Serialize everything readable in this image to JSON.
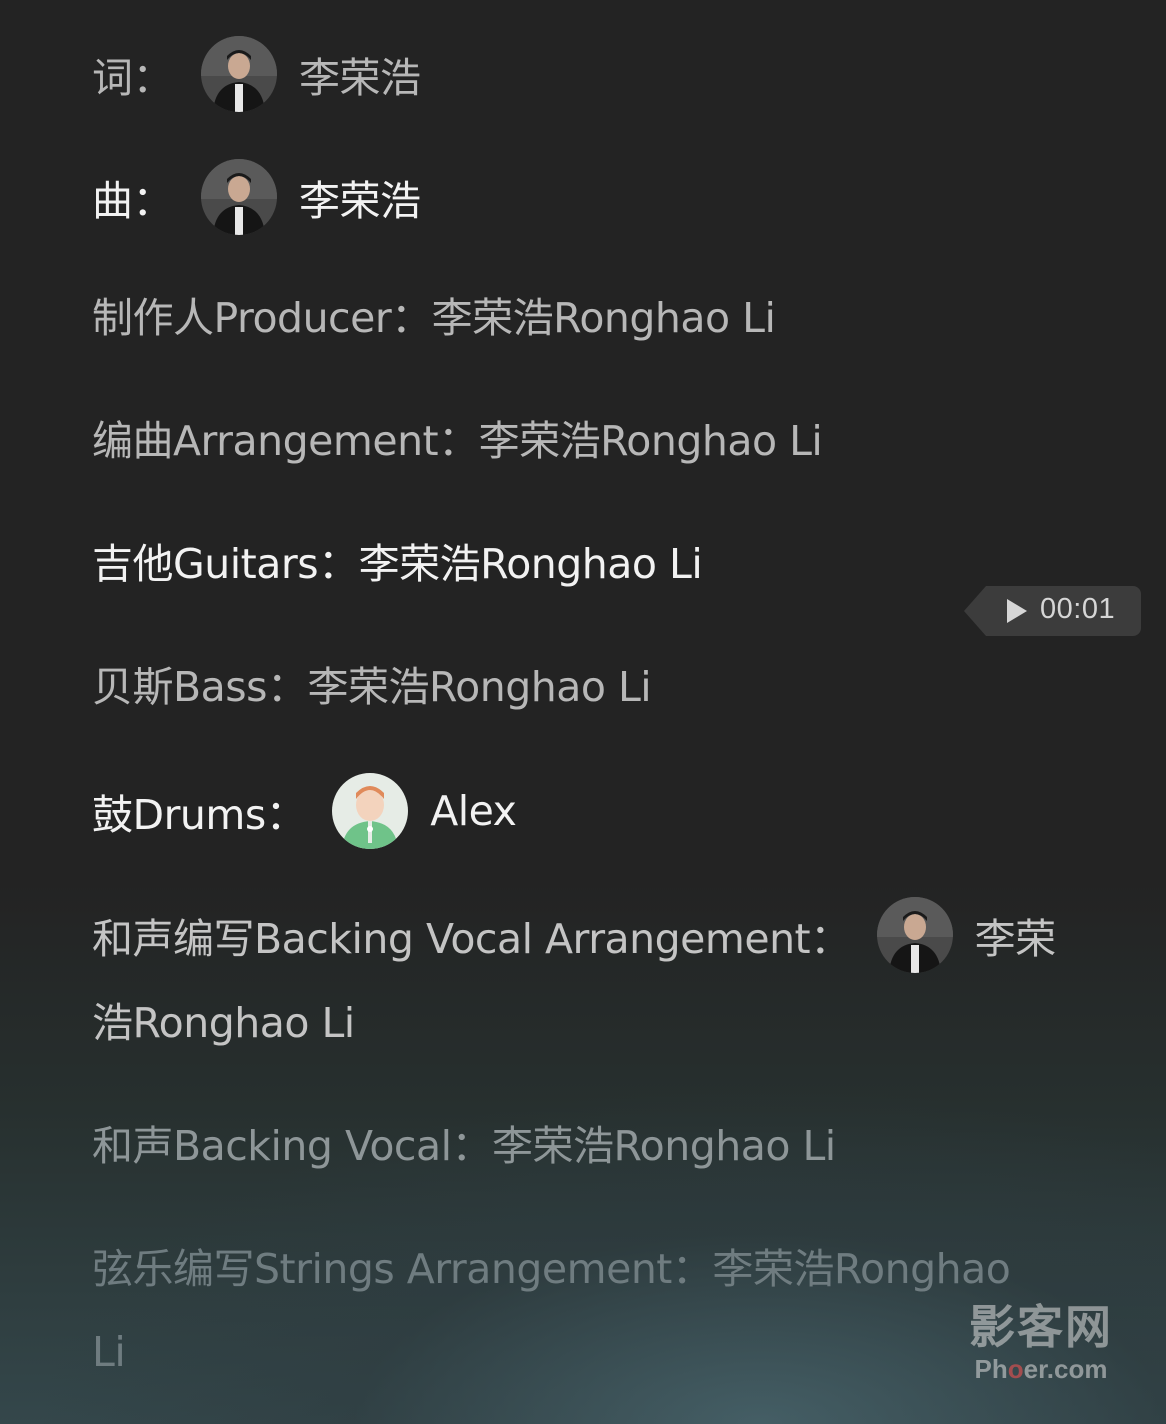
{
  "lyrics": {
    "line1": {
      "label": "词：",
      "name": "李荣浩"
    },
    "line2": {
      "label": "曲：",
      "name": "李荣浩"
    },
    "line3": {
      "text": "制作人Producer：李荣浩Ronghao Li"
    },
    "line4": {
      "text": "编曲Arrangement：李荣浩Ronghao Li"
    },
    "line5": {
      "text": "吉他Guitars：李荣浩Ronghao Li"
    },
    "line6": {
      "text": "贝斯Bass：李荣浩Ronghao Li"
    },
    "line7": {
      "label": "鼓Drums：",
      "name": "Alex"
    },
    "line8": {
      "label": "和声编写Backing Vocal Arrangement：",
      "name": "李荣",
      "cont": "浩Ronghao Li"
    },
    "line9": {
      "text": "和声Backing Vocal：李荣浩Ronghao Li"
    },
    "line10": {
      "text": "弦乐编写Strings Arrangement：李荣浩Ronghao",
      "cont": "Li"
    }
  },
  "seek_bubble": {
    "time": "00:01",
    "icon": "play-icon"
  },
  "watermark": {
    "cn": "影客网",
    "en_pre": "Ph",
    "en_o": "o",
    "en_post": "er.com"
  },
  "colors": {
    "background": "#232323",
    "active_text": "#f2f2f2",
    "inactive_text": "#b7b7b7"
  }
}
